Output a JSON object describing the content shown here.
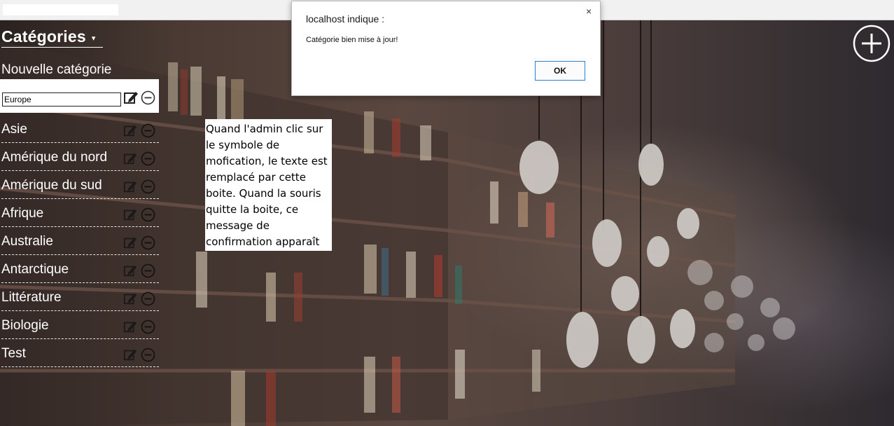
{
  "sidebar": {
    "header": {
      "title": "Catégories",
      "caret": "▾"
    },
    "new_category_label": "Nouvelle catégorie",
    "edit_value": "Europe",
    "categories": [
      {
        "label": "Asie"
      },
      {
        "label": "Amérique du nord"
      },
      {
        "label": "Amérique du sud"
      },
      {
        "label": "Afrique"
      },
      {
        "label": "Australie"
      },
      {
        "label": "Antarctique"
      },
      {
        "label": "Littérature"
      },
      {
        "label": "Biologie"
      },
      {
        "label": "Test"
      }
    ],
    "icons": {
      "edit": "edit-icon",
      "remove": "minus-circle-icon"
    }
  },
  "note": {
    "text": "Quand l'admin clic sur le symbole de mofication, le texte est remplacé par cette boite. Quand la souris quitte la boite, ce message de confirmation apparaît"
  },
  "add_button": {
    "icon": "plus-circle-icon"
  },
  "dialog": {
    "title": "localhost indique :",
    "message": "Catégorie bien mise à jour!",
    "ok_label": "OK",
    "close_glyph": "×"
  },
  "colors": {
    "text_light": "#ffffff",
    "dialog_ok_border": "#2b7bd6",
    "background_dark": "#2b2525"
  }
}
